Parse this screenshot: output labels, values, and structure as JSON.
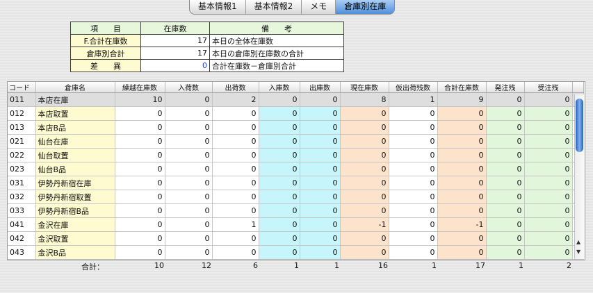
{
  "tabs": [
    "基本情報1",
    "基本情報2",
    "メモ",
    "倉庫別在庫"
  ],
  "active_tab": 3,
  "summary": {
    "headers": [
      "項　　目",
      "在庫数",
      "備　　考"
    ],
    "rows": [
      {
        "label": "F.合計在庫数",
        "value": "17",
        "note": "本日の全体在庫数"
      },
      {
        "label": "倉庫別合計",
        "value": "17",
        "note": "本日の倉庫別在庫数の合計"
      },
      {
        "label": "差　　異",
        "value": "0",
        "note": "合計在庫数－倉庫別合計"
      }
    ]
  },
  "grid": {
    "columns": [
      "コード",
      "倉庫名",
      "繰越在庫数",
      "入荷数",
      "出荷数",
      "入庫数",
      "出庫数",
      "現在庫数",
      "仮出荷残数",
      "合計在庫数",
      "発注残",
      "受注残"
    ],
    "rows": [
      [
        "011",
        "本店在庫",
        "10",
        "0",
        "2",
        "0",
        "0",
        "8",
        "1",
        "9",
        "0",
        "0"
      ],
      [
        "012",
        "本店取置",
        "0",
        "0",
        "0",
        "0",
        "0",
        "0",
        "0",
        "0",
        "0",
        "0"
      ],
      [
        "013",
        "本店B品",
        "0",
        "0",
        "0",
        "0",
        "0",
        "0",
        "0",
        "0",
        "0",
        "0"
      ],
      [
        "021",
        "仙台在庫",
        "0",
        "0",
        "0",
        "0",
        "0",
        "0",
        "0",
        "0",
        "0",
        "0"
      ],
      [
        "022",
        "仙台取置",
        "0",
        "0",
        "0",
        "0",
        "0",
        "0",
        "0",
        "0",
        "0",
        "0"
      ],
      [
        "023",
        "仙台B品",
        "0",
        "0",
        "0",
        "0",
        "0",
        "0",
        "0",
        "0",
        "0",
        "0"
      ],
      [
        "031",
        "伊勢丹新宿在庫",
        "0",
        "0",
        "0",
        "0",
        "0",
        "0",
        "0",
        "0",
        "0",
        "0"
      ],
      [
        "032",
        "伊勢丹新宿取置",
        "0",
        "0",
        "0",
        "0",
        "0",
        "0",
        "0",
        "0",
        "0",
        "0"
      ],
      [
        "033",
        "伊勢丹新宿B品",
        "0",
        "0",
        "0",
        "0",
        "0",
        "0",
        "0",
        "0",
        "0",
        "0"
      ],
      [
        "041",
        "金沢在庫",
        "0",
        "0",
        "1",
        "0",
        "0",
        "-1",
        "0",
        "-1",
        "0",
        "0"
      ],
      [
        "042",
        "金沢取置",
        "0",
        "0",
        "0",
        "0",
        "0",
        "0",
        "0",
        "0",
        "0",
        "0"
      ],
      [
        "043",
        "金沢B品",
        "0",
        "0",
        "0",
        "0",
        "0",
        "0",
        "0",
        "0",
        "0",
        "0"
      ]
    ]
  },
  "totals": {
    "label": "合計：",
    "values": [
      "10",
      "12",
      "6",
      "1",
      "1",
      "16",
      "1",
      "17",
      "1",
      "2"
    ]
  }
}
